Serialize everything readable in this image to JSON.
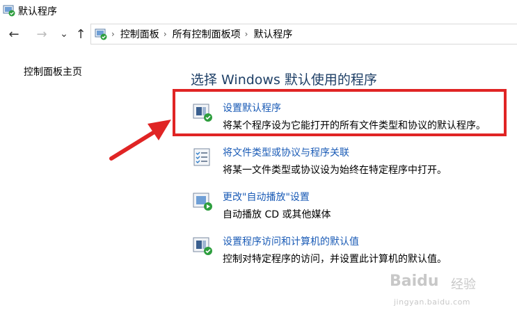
{
  "window": {
    "title": "默认程序",
    "icon": "control-panel-icon"
  },
  "nav": {
    "back_icon": "←",
    "forward_icon": "→",
    "recent_icon": "⌄",
    "up_icon": "↑"
  },
  "breadcrumb": {
    "items": [
      "控制面板",
      "所有控制面板项",
      "默认程序"
    ],
    "separator": "›"
  },
  "sidebar": {
    "home_link": "控制面板主页"
  },
  "main": {
    "heading": "选择 Windows 默认使用的程序",
    "tasks": [
      {
        "icon": "default-programs-icon",
        "link": "设置默认程序",
        "description": "将某个程序设为它能打开的所有文件类型和协议的默认程序。"
      },
      {
        "icon": "file-association-icon",
        "link": "将文件类型或协议与程序关联",
        "description": "将某一文件类型或协议设为始终在特定程序中打开。"
      },
      {
        "icon": "autoplay-icon",
        "link": "更改\"自动播放\"设置",
        "description": "自动播放 CD 或其他媒体"
      },
      {
        "icon": "program-access-icon",
        "link": "设置程序访问和计算机的默认值",
        "description": "控制对特定程序的访问，并设置此计算机的默认值。"
      }
    ]
  },
  "watermark": {
    "brand": "Baidu",
    "service": "经验",
    "url": "jingyan.baidu.com"
  },
  "colors": {
    "link": "#1a5bb6",
    "heading": "#1e3f66",
    "annotation": "#e02424"
  }
}
